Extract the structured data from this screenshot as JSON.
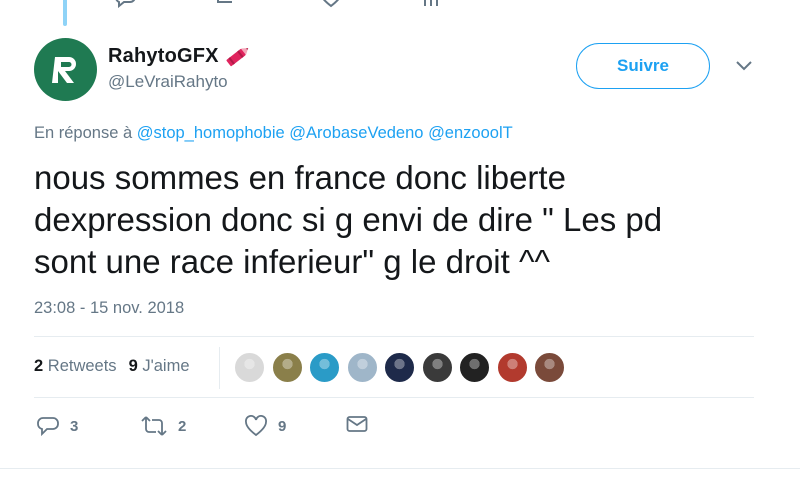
{
  "author": {
    "display_name": "RahytoGFX",
    "handle": "@LeVraiRahyto",
    "avatar_letter": "R",
    "avatar_color": "#1f7a52",
    "emoji_icon": "crayon-icon"
  },
  "follow_button": {
    "label": "Suivre"
  },
  "reply": {
    "prefix": "En réponse à",
    "mentions": [
      "@stop_homophobie",
      "@ArobaseVedeno",
      "@enzooolT"
    ]
  },
  "tweet": {
    "lines": [
      "nous sommes en france donc liberte",
      "dexpression donc si g envi de dire \" Les pd",
      "sont une race inferieur\" g le droit ^^"
    ],
    "timestamp": "23:08 - 15 nov. 2018"
  },
  "stats": {
    "retweets_count": "2",
    "retweets_label": "Retweets",
    "likes_count": "9",
    "likes_label": "J'aime"
  },
  "likers": [
    {
      "name": "liker-1",
      "color": "#d9d9d9"
    },
    {
      "name": "liker-2",
      "color": "#8a7f4a"
    },
    {
      "name": "liker-3",
      "color": "#2a9bc7"
    },
    {
      "name": "liker-4",
      "color": "#9fb6c9"
    },
    {
      "name": "liker-5",
      "color": "#1e2a4a"
    },
    {
      "name": "liker-6",
      "color": "#3a3a3a"
    },
    {
      "name": "liker-7",
      "color": "#222222"
    },
    {
      "name": "liker-8",
      "color": "#b23a2e"
    },
    {
      "name": "liker-9",
      "color": "#7a4a3a"
    }
  ],
  "actions": {
    "reply_count": "3",
    "retweet_count": "2",
    "like_count": "9"
  },
  "colors": {
    "accent": "#1da1f2",
    "muted": "#657786",
    "text": "#14171a"
  }
}
